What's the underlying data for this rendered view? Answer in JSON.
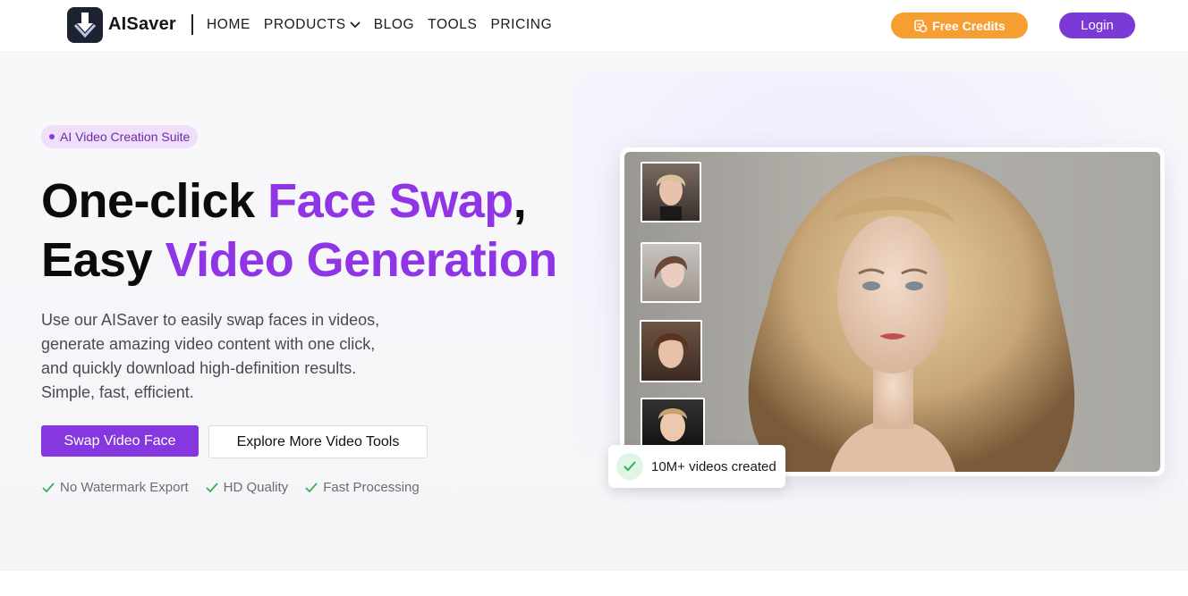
{
  "header": {
    "brand": "AISaver",
    "nav": [
      {
        "label": "HOME"
      },
      {
        "label": "PRODUCTS"
      },
      {
        "label": "BLOG"
      },
      {
        "label": "TOOLS"
      },
      {
        "label": "PRICING"
      }
    ],
    "credits_label": "Free Credits",
    "login_label": "Login"
  },
  "hero": {
    "badge": "AI Video Creation Suite",
    "title_line1_a": "One-click ",
    "title_line1_b": "Face Swap",
    "title_line1_c": ",",
    "title_line2_a": "Easy ",
    "title_line2_b": "Video Generation",
    "description": "Use our AISaver to easily swap faces in videos, generate amazing video content with one click, and quickly download high-definition results. Simple, fast, efficient.",
    "primary_button": "Swap Video Face",
    "secondary_button": "Explore More Video Tools",
    "features": [
      "No Watermark Export",
      "HD Quality",
      "Fast Processing"
    ]
  },
  "media": {
    "stat": "10M+ videos created"
  },
  "colors": {
    "accent": "#8f35e6",
    "credits": "#f79e32",
    "login": "#7b39d6",
    "check": "#2fb15a"
  }
}
